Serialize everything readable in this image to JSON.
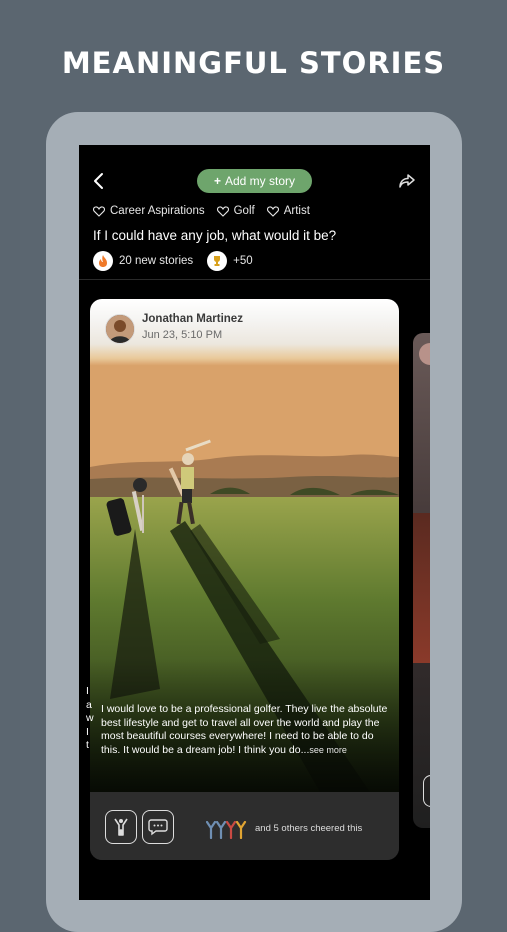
{
  "headline": "MEANINGFUL STORIES",
  "header": {
    "add_story_label": "Add my story"
  },
  "tags": [
    {
      "label": "Career Aspirations"
    },
    {
      "label": "Golf"
    },
    {
      "label": "Artist"
    }
  ],
  "question": "If I could have any job, what would it be?",
  "stats": {
    "stories": "20 new stories",
    "trophies": "+50"
  },
  "card": {
    "author": "Jonathan Martinez",
    "date": "Jun 23, 5:10 PM",
    "text": "I would love to be a professional golfer. They live the absolute best lifestyle and get to travel all over the world and play the most beautiful courses everywhere! I need to be able to do this. It would be a dream job! I think you do...",
    "see_more": "see more",
    "cheers_text": "and 5 others cheered this"
  },
  "next_card": {
    "text_lines": [
      "I",
      "a",
      "w",
      "I",
      "t"
    ]
  },
  "colors": {
    "background": "#5b6670",
    "device_frame": "#a5aeb6",
    "accent_green": "#6ea56c",
    "cheer_colors": [
      "#6f8fb3",
      "#6f8fb3",
      "#c94a43",
      "#e0a432"
    ]
  }
}
